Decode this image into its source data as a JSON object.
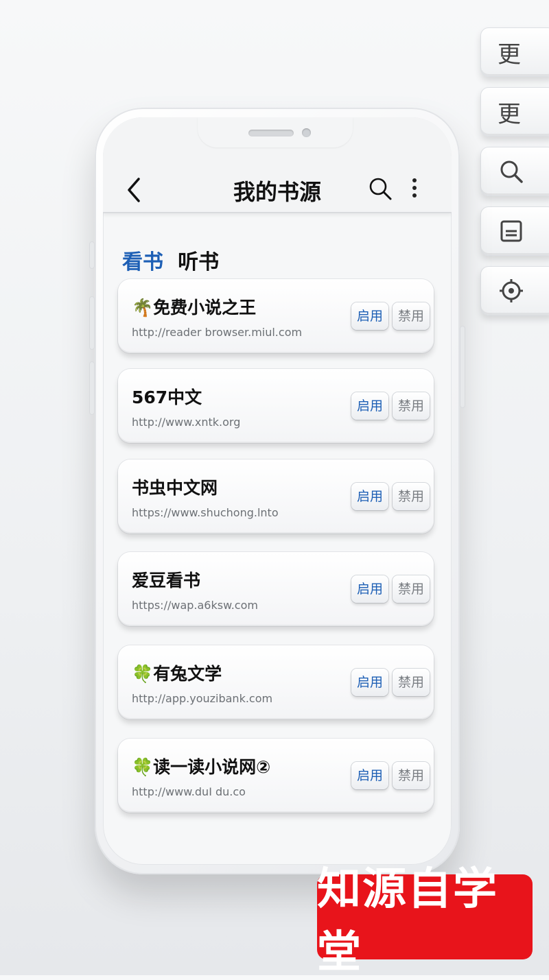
{
  "side_keys": [
    {
      "type": "text",
      "text": "更"
    },
    {
      "type": "text",
      "text": "更"
    },
    {
      "type": "icon",
      "icon": "search-icon"
    },
    {
      "type": "icon",
      "icon": "window-icon"
    },
    {
      "type": "icon",
      "icon": "locate-icon"
    }
  ],
  "header": {
    "title": "我的书源",
    "back_icon": "chevron-left-icon",
    "search_icon": "search-icon",
    "more_icon": "more-vertical-icon"
  },
  "tabs": [
    {
      "label": "看书",
      "active": true
    },
    {
      "label": "听书",
      "active": false
    }
  ],
  "sources": [
    {
      "emoji": "🌴",
      "name": "免费小说之王",
      "url": "http://reader browser.miul.com"
    },
    {
      "emoji": "",
      "name": "567中文",
      "url": "http://www.xntk.org"
    },
    {
      "emoji": "",
      "name": "书虫中文网",
      "url": "https://www.shuchong.lnto"
    },
    {
      "emoji": "",
      "name": "爱豆看书",
      "url": "https://wap.a6ksw.com"
    },
    {
      "emoji": "🍀",
      "name": "有兔文学",
      "url": "http://app.youzibank.com"
    },
    {
      "emoji": "🍀",
      "name": "读一读小说网②",
      "url": "http://www.duI du.co"
    }
  ],
  "buttons": {
    "enable": "启用",
    "disable": "禁用"
  },
  "brand": {
    "text": "知源自学堂"
  },
  "colors": {
    "accent": "#1d5fb5",
    "brand_bg": "#e8141b"
  }
}
